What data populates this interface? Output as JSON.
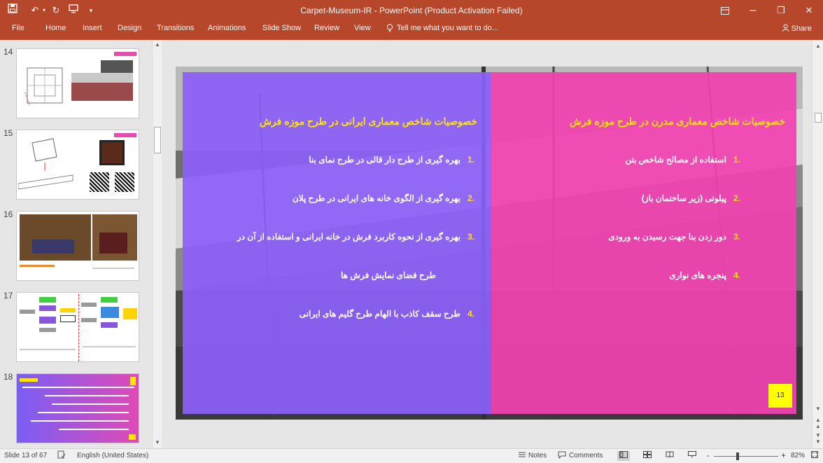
{
  "app": {
    "title": "Carpet-Museum-IR - PowerPoint (Product Activation Failed)"
  },
  "quick_access": {
    "save_icon": "save-icon",
    "undo_icon": "undo-icon",
    "redo_icon": "redo-icon",
    "present_icon": "present-from-start-icon",
    "customize_icon": "customize-toolbar-icon"
  },
  "window": {
    "ribbon_display_icon": "ribbon-display-options-icon",
    "minimize": "─",
    "restore": "❐",
    "close": "✕"
  },
  "ribbon": {
    "tabs": [
      "File",
      "Home",
      "Insert",
      "Design",
      "Transitions",
      "Animations",
      "Slide Show",
      "Review",
      "View"
    ],
    "tell_me": "Tell me what you want to do...",
    "share": "Share"
  },
  "thumbnails": [
    {
      "number": "14"
    },
    {
      "number": "15"
    },
    {
      "number": "16"
    },
    {
      "number": "17"
    },
    {
      "number": "18"
    }
  ],
  "slide": {
    "left_heading": "خصوصیات شاخص معماری ایرانی در طرح موزه فرش",
    "left_items": [
      {
        "num": ".1",
        "text": "بهره گیری از طرح دار قالی در طرح نمای بنا"
      },
      {
        "num": ".2",
        "text": "بهره گیری از الگوی خانه های ایرانی در طرح پلان"
      },
      {
        "num": ".3",
        "text": "بهره گیری از نحوه کاربرد فرش در خانه ایرانی و استفاده از آن در"
      },
      {
        "num": "",
        "text": "طرح فضای نمایش فرش ها"
      },
      {
        "num": ".4",
        "text": "طرح سقف کاذب با الهام طرح گلیم های ایرانی"
      }
    ],
    "right_heading": "خصوصیات شاخص معماری مدرن در طرح موزه فرش",
    "right_items": [
      {
        "num": ".1",
        "text": "استفاده از مصالح شاخص بتن"
      },
      {
        "num": ".2",
        "text": "پیلوتی (زیر ساختمان باز)"
      },
      {
        "num": ".3",
        "text": "دور زدن بنا جهت رسیدن به ورودی"
      },
      {
        "num": ".4",
        "text": "پنجره های نواری"
      }
    ],
    "page_number": "13",
    "colors": {
      "left_panel": "#8b60f8",
      "right_panel": "#f042b0",
      "heading": "#ffe600"
    }
  },
  "status": {
    "slide_info": "Slide 13 of 67",
    "language": "English (United States)",
    "notes": "Notes",
    "comments": "Comments",
    "zoom": "82%",
    "zoom_minus": "-",
    "zoom_plus": "+"
  }
}
